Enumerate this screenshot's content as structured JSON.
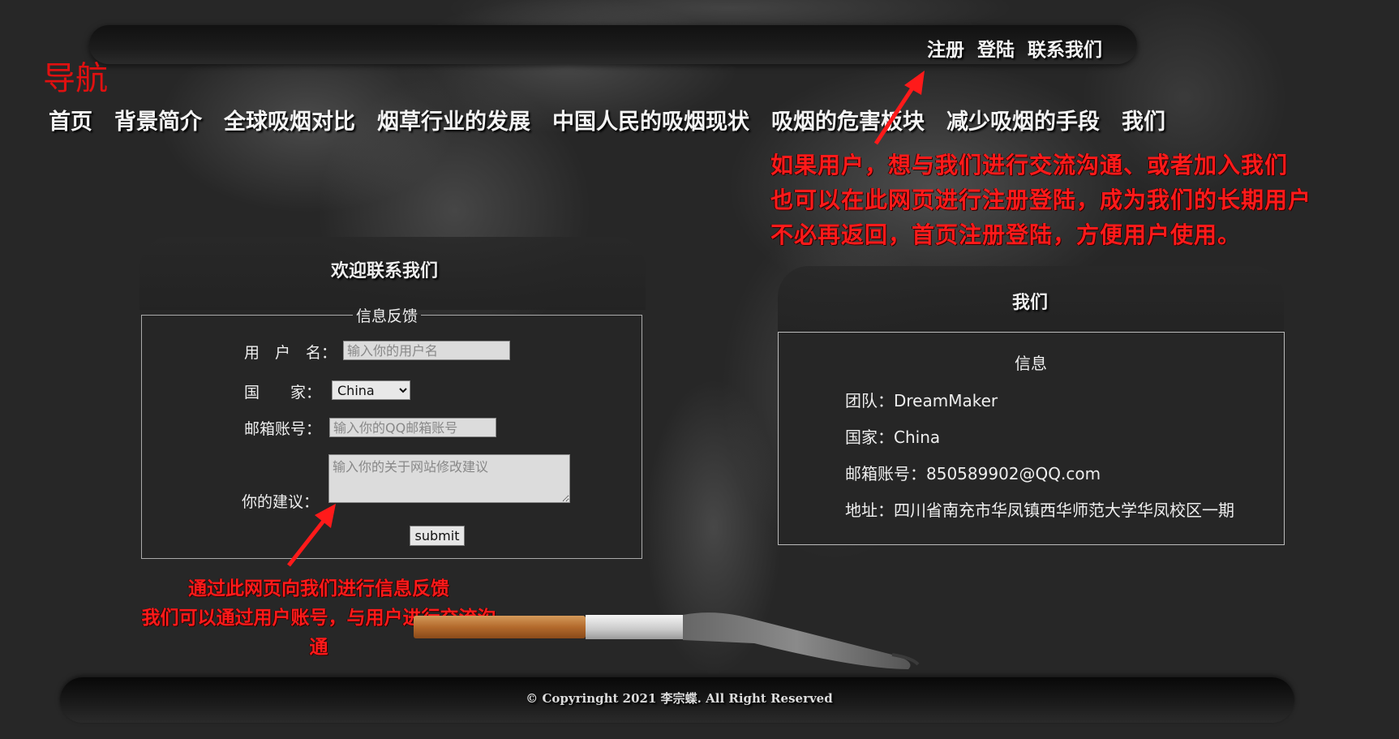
{
  "top_links": [
    "注册",
    "登陆",
    "联系我们"
  ],
  "nav_title": "导航",
  "main_nav": [
    "首页",
    "背景简介",
    "全球吸烟对比",
    "烟草行业的发展",
    "中国人民的吸烟现状",
    "吸烟的危害板块",
    "减少吸烟的手段",
    "我们"
  ],
  "annotations": {
    "top": [
      "如果用户，想与我们进行交流沟通、或者加入我们",
      "也可以在此网页进行注册登陆，成为我们的长期用户",
      "不必再返回，首页注册登陆，方便用户使用。"
    ],
    "bottom": [
      "通过此网页向我们进行信息反馈",
      "我们可以通过用户账号，与用户进行交流沟通"
    ]
  },
  "contact_panel": {
    "title": "欢迎联系我们",
    "legend": "信息反馈",
    "username_label": "用　户　名：",
    "username_placeholder": "输入你的用户名",
    "country_label": "国　　家：",
    "country_selected": "China",
    "email_label": "邮箱账号：",
    "email_placeholder": "输入你的QQ邮箱账号",
    "suggestion_label": "你的建议：",
    "suggestion_placeholder": "输入你的关于网站修改建议",
    "submit_label": "submit"
  },
  "about_panel": {
    "title": "我们",
    "heading": "信息",
    "team": "团队：DreamMaker",
    "country": "国家：China",
    "email": "邮箱账号：850589902@QQ.com",
    "address": "地址：四川省南充市华凤镇西华师范大学华凤校区一期"
  },
  "footer": "© Copyringht 2021 李宗蝶. All Right Reserved",
  "colors": {
    "annotation": "#ff1a1a",
    "nav_title": "#e01010",
    "background": "#272727"
  }
}
